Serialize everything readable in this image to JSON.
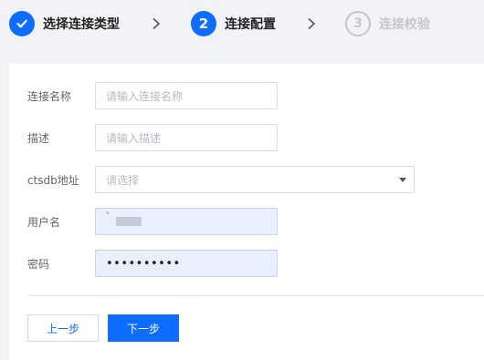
{
  "steps": [
    {
      "index": "",
      "label": "选择连接类型",
      "state": "done",
      "icon": "check-icon"
    },
    {
      "index": "2",
      "label": "连接配置",
      "state": "active"
    },
    {
      "index": "3",
      "label": "连接校验",
      "state": "pending"
    }
  ],
  "form": {
    "name": {
      "label": "连接名称",
      "placeholder": "请输入连接名称"
    },
    "desc": {
      "label": "描述",
      "placeholder": "请输入描述"
    },
    "address": {
      "label": "ctsdb地址",
      "placeholder": "请选择"
    },
    "username": {
      "label": "用户名",
      "value": "`"
    },
    "password": {
      "label": "密码",
      "value": "••••••••••"
    }
  },
  "buttons": {
    "prev": "上一步",
    "next": "下一步"
  },
  "colors": {
    "primary": "#0e6cff",
    "autofill": "#e8f0fe",
    "pending": "#c5c7cc"
  }
}
